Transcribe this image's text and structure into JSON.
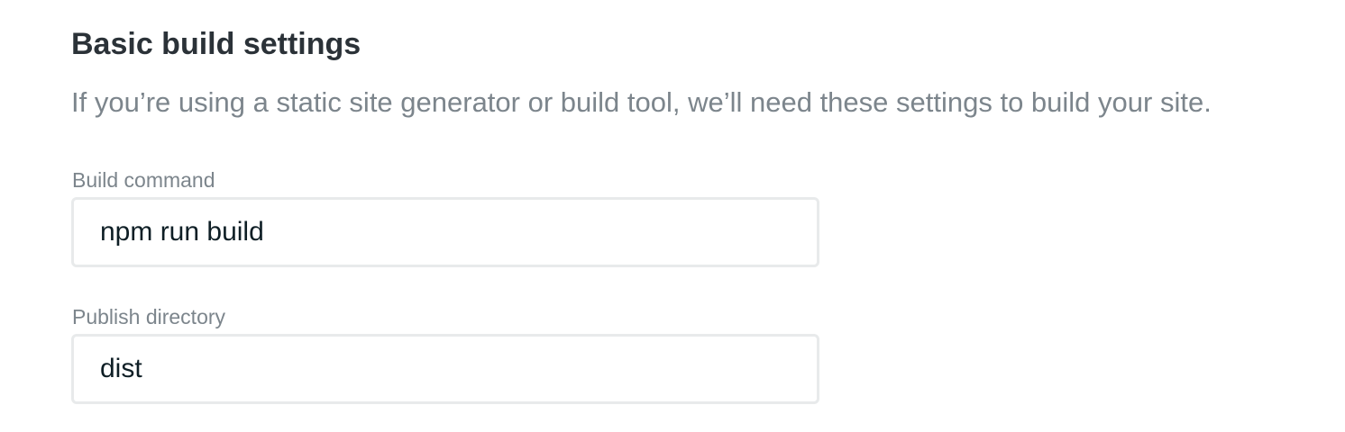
{
  "settings": {
    "title": "Basic build settings",
    "description": "If you’re using a static site generator or build tool, we’ll need these settings to build your site.",
    "build_command": {
      "label": "Build command",
      "value": "npm run build"
    },
    "publish_directory": {
      "label": "Publish directory",
      "value": "dist"
    }
  },
  "colors": {
    "heading": "#2b3238",
    "muted_text": "#7c858c",
    "input_text": "#0e1e25",
    "input_border": "#e8eaeb",
    "background": "#ffffff"
  }
}
